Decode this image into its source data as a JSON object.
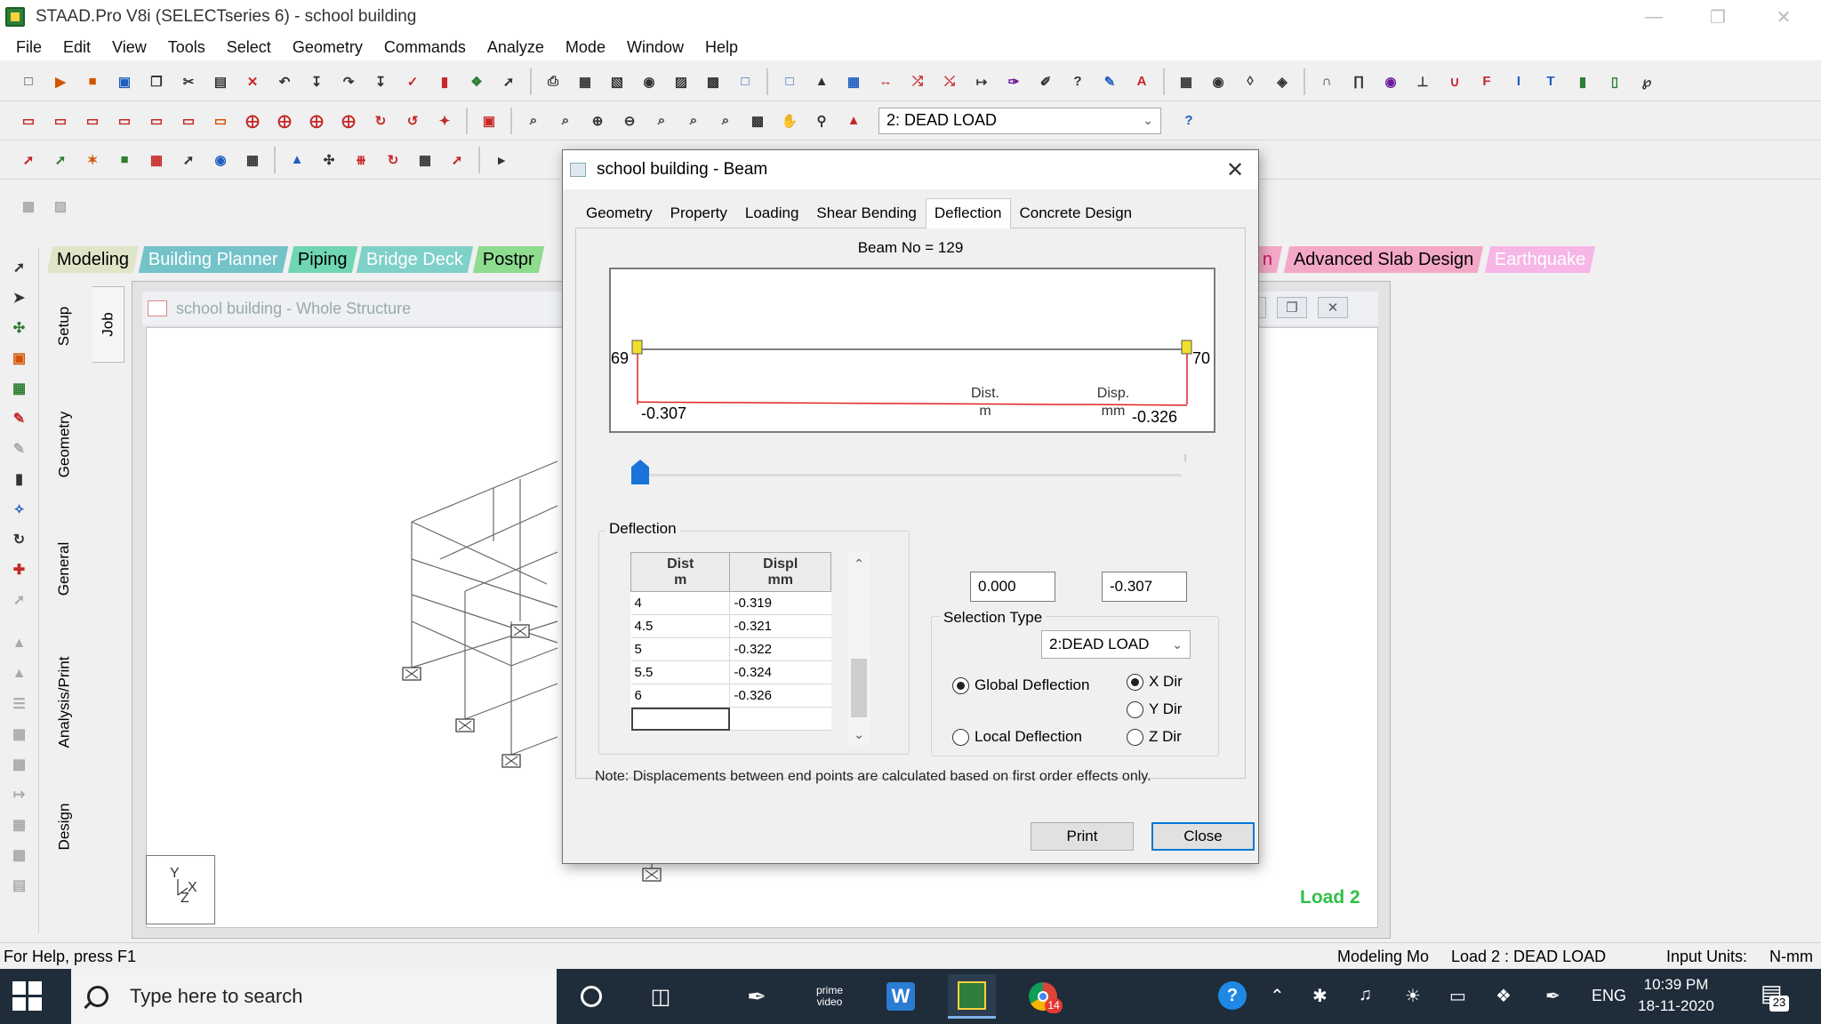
{
  "window": {
    "title": "STAAD.Pro V8i (SELECTseries 6) - school building"
  },
  "menu": [
    "File",
    "Edit",
    "View",
    "Tools",
    "Select",
    "Geometry",
    "Commands",
    "Analyze",
    "Mode",
    "Window",
    "Help"
  ],
  "toolbar": {
    "load_case": "2: DEAD LOAD"
  },
  "mode_tabs": [
    {
      "label": "Modeling",
      "bg": "#dfe6c8",
      "fg": "#000000"
    },
    {
      "label": "Building Planner",
      "bg": "#73c3c9",
      "fg": "#ffffff"
    },
    {
      "label": "Piping",
      "bg": "#6fd6b3",
      "fg": "#000000"
    },
    {
      "label": "Bridge Deck",
      "bg": "#7fd0c8",
      "fg": "#ffffff"
    },
    {
      "label": "Postpr",
      "bg": "#8ddc8f",
      "fg": "#000000"
    }
  ],
  "mode_tabs_right": [
    {
      "label": "n",
      "bg": "#f4a8c8",
      "fg": "#c2185b"
    },
    {
      "label": "Advanced Slab Design",
      "bg": "#f4a8c8",
      "fg": "#000000"
    },
    {
      "label": "Earthquake",
      "bg": "#f6b6e6",
      "fg": "#ffffff"
    }
  ],
  "page_control": {
    "job": "Job",
    "setup": "Setup",
    "geometry": "Geometry",
    "general": "General",
    "analysis_print": "Analysis/Print",
    "design": "Design"
  },
  "structure_window": {
    "title": "school building - Whole Structure",
    "load_label": "Load 2"
  },
  "dialog": {
    "title": "school building - Beam",
    "tabs": [
      "Geometry",
      "Property",
      "Loading",
      "Shear Bending",
      "Deflection",
      "Concrete Design"
    ],
    "active_tab": "Deflection",
    "beam_no": "Beam No = 129",
    "diagram": {
      "start_node": "69",
      "end_node": "70",
      "start_value": "-0.307",
      "end_value": "-0.326",
      "beam_length_m": 6,
      "deflection_mm": [
        [
          0,
          -0.307
        ],
        [
          0.5,
          -0.309
        ],
        [
          4,
          -0.319
        ],
        [
          4.5,
          -0.321
        ],
        [
          5,
          -0.322
        ],
        [
          5.5,
          -0.324
        ],
        [
          6,
          -0.326
        ]
      ]
    },
    "slider_position": 0,
    "deflection_group": {
      "label": "Deflection",
      "col1_line1": "Dist",
      "col1_line2": "m",
      "col2_line1": "Displ",
      "col2_line2": "mm",
      "rows": [
        {
          "dist": "4",
          "displ": "-0.319"
        },
        {
          "dist": "4.5",
          "displ": "-0.321"
        },
        {
          "dist": "5",
          "displ": "-0.322"
        },
        {
          "dist": "5.5",
          "displ": "-0.324"
        },
        {
          "dist": "6",
          "displ": "-0.326"
        }
      ]
    },
    "dist_header": {
      "line1": "Dist.",
      "line2": "m"
    },
    "disp_header": {
      "line1": "Disp.",
      "line2": "mm"
    },
    "dist_value": "0.000",
    "disp_value": "-0.307",
    "selection_type": {
      "label": "Selection Type",
      "value": "2:DEAD LOAD",
      "global": "Global Deflection",
      "local": "Local Deflection",
      "x_dir": "X Dir",
      "y_dir": "Y Dir",
      "z_dir": "Z Dir"
    },
    "note": "Note: Displacements between end points are calculated based on first order effects only.",
    "print_label": "Print",
    "close_label": "Close"
  },
  "statusbar": {
    "help": "For Help, press F1",
    "mode": "Modeling Mo",
    "load": "Load 2 : DEAD LOAD",
    "units": "Input Units:",
    "units_value": "N-mm"
  },
  "taskbar": {
    "search_placeholder": "Type here to search",
    "prime_line1": "prime",
    "prime_line2": "video",
    "chrome_badge": "14",
    "lang": "ENG",
    "time": "10:39 PM",
    "date": "18-11-2020",
    "notifications": "23"
  }
}
